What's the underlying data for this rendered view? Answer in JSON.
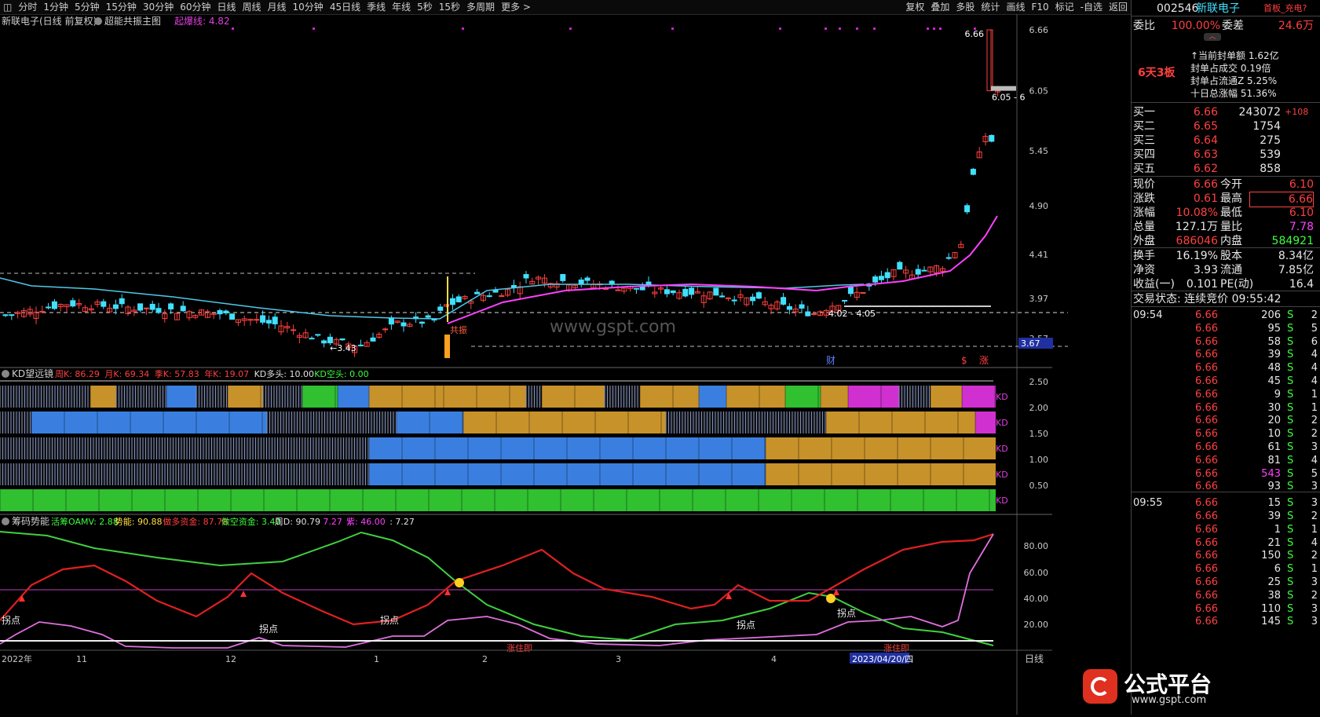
{
  "toolbar": {
    "periods": [
      "分时",
      "1分钟",
      "5分钟",
      "15分钟",
      "30分钟",
      "60分钟",
      "日线",
      "周线",
      "月线",
      "10分钟",
      "45日线",
      "季线",
      "年线",
      "5秒",
      "15秒",
      "多周期",
      "更多 >"
    ],
    "tools": [
      "复权",
      "叠加",
      "多股",
      "统计",
      "画线",
      "F10",
      "标记",
      "-自选",
      "返回"
    ]
  },
  "main": {
    "title": "新联电子(日线 前复权)",
    "indicator": "超能共振主图",
    "param_label": "起爆线: 4.82",
    "axis_labels": [
      "6.66",
      "6.05",
      "5.45",
      "4.90",
      "4.41",
      "3.97",
      "3.57"
    ],
    "annotations": {
      "high": "6.66",
      "limit_box": "6.05 - 6",
      "low": "←3.43",
      "range": "4.02 - 4.05",
      "cur": "3.67",
      "fin": "财",
      "tags": [
        "$",
        "涨"
      ],
      "zhen": "共振"
    },
    "watermark": "www.gspt.com"
  },
  "kd": {
    "title": "KD望远镜",
    "params": [
      {
        "t": "周K: 86.29",
        "c": "#ff4040"
      },
      {
        "t": "月K: 69.34",
        "c": "#ff4040"
      },
      {
        "t": "季K: 57.83",
        "c": "#ff4040"
      },
      {
        "t": "年K: 19.07",
        "c": "#ff4040"
      },
      {
        "t": "KD多头: 10.00",
        "c": "#e0e0e0"
      },
      {
        "t": "KD空头: 0.00",
        "c": "#3cff3c"
      }
    ],
    "axis_labels": [
      "2.50",
      "2.00",
      "1.50",
      "1.00",
      "0.50"
    ],
    "row_tag": "KD"
  },
  "chip": {
    "title": "筹码势能",
    "params": [
      {
        "t": "活筹OAMV: 2.88",
        "c": "#3cff3c"
      },
      {
        "t": "势能: 90.88",
        "c": "#ffe040"
      },
      {
        "t": "做多资金: 87.78",
        "c": "#ff4040"
      },
      {
        "t": "做空资金: 3.40",
        "c": "#3cff3c"
      },
      {
        "t": "周D: 90.79",
        "c": "#e0e0e0"
      },
      {
        "t": "7.27",
        "c": "#ff40ff"
      },
      {
        "t": "紫: 46.00",
        "c": "#ff40ff"
      },
      {
        "t": ": 7.27",
        "c": "#e0e0e0"
      }
    ],
    "axis_labels": [
      "80.00",
      "60.00",
      "40.00",
      "20.00"
    ],
    "labels": {
      "guaidian": "拐点",
      "zhuang": "涨住即"
    }
  },
  "dates": {
    "labels": [
      "2022年",
      "11",
      "12",
      "1",
      "2",
      "3",
      "4"
    ],
    "highlight": "2023/04/20/四",
    "period": "日线"
  },
  "quote": {
    "code": "002546",
    "name": "新联电子",
    "tag": "首板_充电?",
    "webi_label": "委比",
    "webi_value": "100.00%",
    "wecha_label": "委差",
    "wecha_value": "24.6万",
    "board_tag": "6天3板",
    "seal_info": [
      "↑当前封单额 1.62亿",
      "封单占成交 0.19倍",
      "封单占流通Z 5.25%",
      "十日总涨幅 51.36%"
    ],
    "bids": [
      {
        "label": "买一",
        "price": "6.66",
        "vol": "243072",
        "chg": "+108"
      },
      {
        "label": "买二",
        "price": "6.65",
        "vol": "1754",
        "chg": ""
      },
      {
        "label": "买三",
        "price": "6.64",
        "vol": "275",
        "chg": ""
      },
      {
        "label": "买四",
        "price": "6.63",
        "vol": "539",
        "chg": ""
      },
      {
        "label": "买五",
        "price": "6.62",
        "vol": "858",
        "chg": ""
      }
    ],
    "stats": [
      {
        "l1": "现价",
        "v1": "6.66",
        "c1": "red",
        "l2": "今开",
        "v2": "6.10",
        "c2": "red"
      },
      {
        "l1": "涨跌",
        "v1": "0.61",
        "c1": "red",
        "l2": "最高",
        "v2": "6.66",
        "c2": "red"
      },
      {
        "l1": "涨幅",
        "v1": "10.08%",
        "c1": "red",
        "l2": "最低",
        "v2": "6.10",
        "c2": "red"
      },
      {
        "l1": "总量",
        "v1": "127.1万",
        "c1": "wht",
        "l2": "量比",
        "v2": "7.78",
        "c2": "mag"
      },
      {
        "l1": "外盘",
        "v1": "686046",
        "c1": "red",
        "l2": "内盘",
        "v2": "584921",
        "c2": "grn"
      }
    ],
    "stats2": [
      {
        "l1": "换手",
        "v1": "16.19%",
        "l2": "股本",
        "v2": "8.34亿"
      },
      {
        "l1": "净资",
        "v1": "3.93",
        "l2": "流通",
        "v2": "7.85亿"
      },
      {
        "l1": "收益(一)",
        "v1": "0.101",
        "l2": "PE(动)",
        "v2": "16.4"
      }
    ],
    "trade_state": "交易状态: 连续竞价 09:55:42",
    "ticks": [
      {
        "t": "09:54",
        "p": "6.66",
        "v": "206",
        "s": "S",
        "n": "2"
      },
      {
        "t": "",
        "p": "6.66",
        "v": "95",
        "s": "S",
        "n": "5"
      },
      {
        "t": "",
        "p": "6.66",
        "v": "58",
        "s": "S",
        "n": "6"
      },
      {
        "t": "",
        "p": "6.66",
        "v": "39",
        "s": "S",
        "n": "4"
      },
      {
        "t": "",
        "p": "6.66",
        "v": "48",
        "s": "S",
        "n": "4"
      },
      {
        "t": "",
        "p": "6.66",
        "v": "45",
        "s": "S",
        "n": "4"
      },
      {
        "t": "",
        "p": "6.66",
        "v": "9",
        "s": "S",
        "n": "1"
      },
      {
        "t": "",
        "p": "6.66",
        "v": "30",
        "s": "S",
        "n": "1"
      },
      {
        "t": "",
        "p": "6.66",
        "v": "20",
        "s": "S",
        "n": "2"
      },
      {
        "t": "",
        "p": "6.66",
        "v": "10",
        "s": "S",
        "n": "2"
      },
      {
        "t": "",
        "p": "6.66",
        "v": "61",
        "s": "S",
        "n": "3"
      },
      {
        "t": "",
        "p": "6.66",
        "v": "81",
        "s": "S",
        "n": "4"
      },
      {
        "t": "",
        "p": "6.66",
        "v": "543",
        "s": "S",
        "n": "5",
        "hl": true
      },
      {
        "t": "",
        "p": "6.66",
        "v": "93",
        "s": "S",
        "n": "3"
      },
      {
        "t": "09:55",
        "p": "6.66",
        "v": "15",
        "s": "S",
        "n": "3"
      },
      {
        "t": "",
        "p": "6.66",
        "v": "39",
        "s": "S",
        "n": "2"
      },
      {
        "t": "",
        "p": "6.66",
        "v": "1",
        "s": "S",
        "n": "1"
      },
      {
        "t": "",
        "p": "6.66",
        "v": "21",
        "s": "S",
        "n": "4"
      },
      {
        "t": "",
        "p": "6.66",
        "v": "150",
        "s": "S",
        "n": "2"
      },
      {
        "t": "",
        "p": "6.66",
        "v": "6",
        "s": "S",
        "n": "1"
      },
      {
        "t": "",
        "p": "6.66",
        "v": "25",
        "s": "S",
        "n": "3"
      },
      {
        "t": "",
        "p": "6.66",
        "v": "38",
        "s": "S",
        "n": "2"
      },
      {
        "t": "",
        "p": "6.66",
        "v": "110",
        "s": "S",
        "n": "3"
      },
      {
        "t": "",
        "p": "6.66",
        "v": "145",
        "s": "S",
        "n": "3"
      }
    ],
    "logo_text": "公式平台",
    "logo_url": "www.gspt.com"
  },
  "colors": {
    "up": "#ff4040",
    "down": "#40e0ff",
    "ma": "#ff40ff",
    "kd_orange": "#c8922a",
    "kd_blue": "#3a7fe0",
    "kd_green": "#30c030"
  }
}
